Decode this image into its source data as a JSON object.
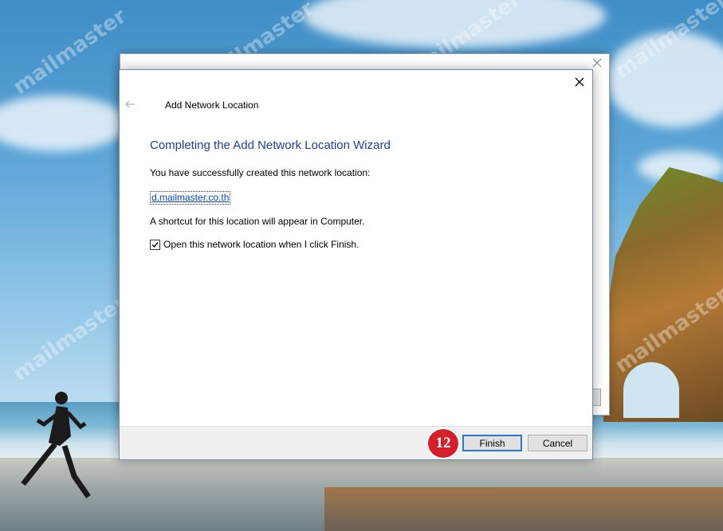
{
  "dialog": {
    "title": "Add Network Location",
    "heading": "Completing the Add Network Location Wizard",
    "success_message": "You have successfully created this network location:",
    "location_link": "d.mailmaster.co.th",
    "shortcut_message": "A shortcut for this location will appear in Computer.",
    "checkbox_label": "Open this network location when I click Finish.",
    "checkbox_checked": true
  },
  "buttons": {
    "finish_label": "Finish",
    "cancel_label": "Cancel"
  },
  "annotation": {
    "step_number": "12",
    "badge_color": "#d51f2a"
  },
  "watermark": {
    "text": "mailmaster"
  },
  "colors": {
    "heading": "#1d3f95",
    "link": "#0645ad",
    "focus_border": "#2a78d6"
  },
  "icons": {
    "close": "close-icon",
    "back": "back-arrow-icon",
    "check": "checkmark-icon"
  }
}
